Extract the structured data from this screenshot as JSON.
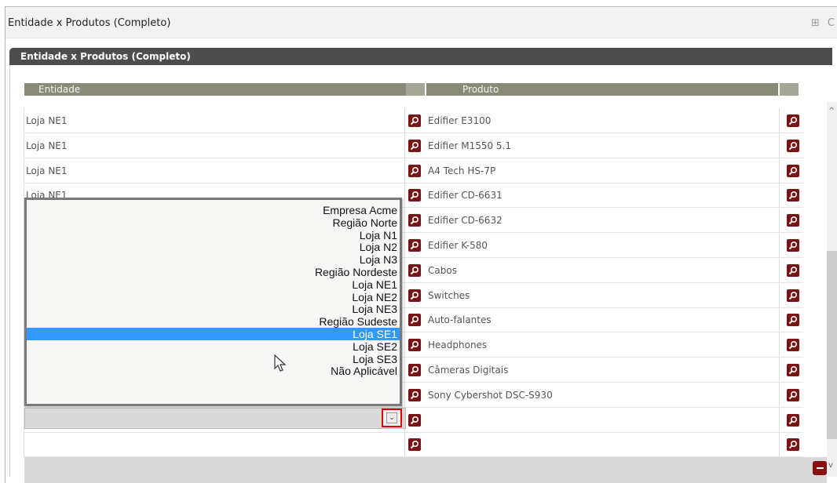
{
  "window": {
    "title": "Entidade x Produtos (Completo)",
    "tools": [
      "⊞",
      "C"
    ]
  },
  "panel": {
    "title": "Entidade x Produtos (Completo)"
  },
  "grid": {
    "columns": [
      "Entidade",
      "Produto"
    ],
    "rows": [
      {
        "entidade": "Loja NE1",
        "produto": "Edifier E3100"
      },
      {
        "entidade": "Loja NE1",
        "produto": "Edifier M1550 5.1"
      },
      {
        "entidade": "Loja NE1",
        "produto": "A4 Tech HS-7P"
      },
      {
        "entidade": "Loja NE1",
        "produto": "Edifier CD-6631"
      },
      {
        "entidade": "",
        "produto": "Edifier CD-6632"
      },
      {
        "entidade": "",
        "produto": "Edifier K-580"
      },
      {
        "entidade": "",
        "produto": "Cabos"
      },
      {
        "entidade": "",
        "produto": "Switches"
      },
      {
        "entidade": "",
        "produto": "Auto-falantes"
      },
      {
        "entidade": "",
        "produto": "Headphones"
      },
      {
        "entidade": "",
        "produto": "Câmeras Digitais"
      },
      {
        "entidade": "",
        "produto": "Sony Cybershot DSC-S930"
      },
      {
        "entidade": "",
        "produto": ""
      },
      {
        "entidade": "",
        "produto": ""
      }
    ]
  },
  "dropdown": {
    "selected": "Loja SE1",
    "options": [
      "Empresa Acme",
      "Região Norte",
      "Loja N1",
      "Loja N2",
      "Loja N3",
      "Região Nordeste",
      "Loja NE1",
      "Loja NE2",
      "Loja NE3",
      "Região Sudeste",
      "Loja SE1",
      "Loja SE2",
      "Loja SE3",
      "Não Aplicável"
    ]
  },
  "colors": {
    "lookup": "#7a1414",
    "selection": "#3399ff",
    "header": "#4d4d4d"
  }
}
